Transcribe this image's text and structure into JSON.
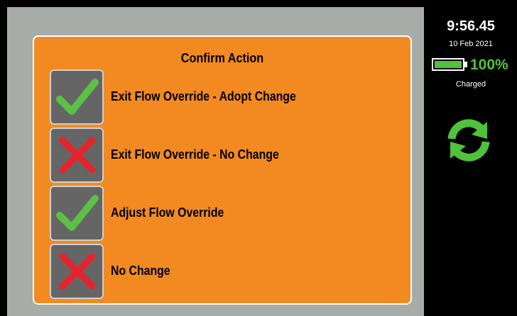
{
  "dialog": {
    "title": "Confirm Action",
    "options": [
      {
        "label": "Exit Flow Override - Adopt Change",
        "icon": "check-icon"
      },
      {
        "label": "Exit Flow Override - No Change",
        "icon": "cross-icon"
      },
      {
        "label": "Adjust Flow Override",
        "icon": "check-icon"
      },
      {
        "label": "No Change",
        "icon": "cross-icon"
      }
    ]
  },
  "status": {
    "time": "9:56.45",
    "date": "10 Feb 2021",
    "battery_percent": "100%",
    "battery_level": 1.0,
    "battery_state": "Charged",
    "sync_icon": "sync-icon"
  },
  "colors": {
    "dialog_bg": "#f28a21",
    "accent_green": "#50c23c",
    "cross_red": "#e8222a",
    "button_gray": "#656565",
    "background_gray": "#a7aca9"
  }
}
